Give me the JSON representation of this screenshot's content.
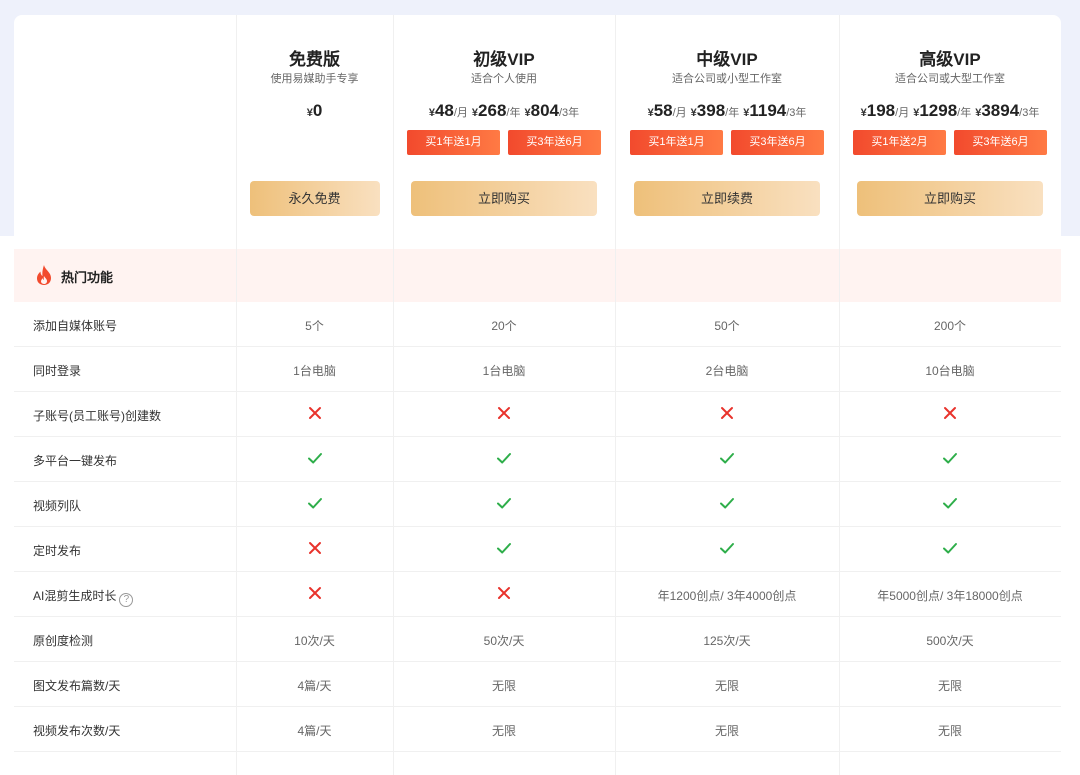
{
  "hot_title": "热门功能",
  "plans": [
    {
      "name": "免费版",
      "desc": "使用易媒助手专享",
      "prices": [
        {
          "cur": "¥",
          "amt": "0",
          "unit": ""
        }
      ],
      "promos": [],
      "button": "永久免费"
    },
    {
      "name": "初级VIP",
      "desc": "适合个人使用",
      "prices": [
        {
          "cur": "¥",
          "amt": "48",
          "unit": "/月"
        },
        {
          "cur": "¥",
          "amt": "268",
          "unit": "/年"
        },
        {
          "cur": "¥",
          "amt": "804",
          "unit": "/3年"
        }
      ],
      "promos": [
        "买1年送1月",
        "买3年送6月"
      ],
      "button": "立即购买"
    },
    {
      "name": "中级VIP",
      "desc": "适合公司或小型工作室",
      "prices": [
        {
          "cur": "¥",
          "amt": "58",
          "unit": "/月"
        },
        {
          "cur": "¥",
          "amt": "398",
          "unit": "/年"
        },
        {
          "cur": "¥",
          "amt": "1194",
          "unit": "/3年"
        }
      ],
      "promos": [
        "买1年送1月",
        "买3年送6月"
      ],
      "button": "立即续费"
    },
    {
      "name": "高级VIP",
      "desc": "适合公司或大型工作室",
      "prices": [
        {
          "cur": "¥",
          "amt": "198",
          "unit": "/月"
        },
        {
          "cur": "¥",
          "amt": "1298",
          "unit": "/年"
        },
        {
          "cur": "¥",
          "amt": "3894",
          "unit": "/3年"
        }
      ],
      "promos": [
        "买1年送2月",
        "买3年送6月"
      ],
      "button": "立即购买"
    }
  ],
  "rows": [
    {
      "feature": "添加自媒体账号",
      "values": [
        "5个",
        "20个",
        "50个",
        "200个"
      ]
    },
    {
      "feature": "同时登录",
      "values": [
        "1台电脑",
        "1台电脑",
        "2台电脑",
        "10台电脑"
      ]
    },
    {
      "feature": "子账号(员工账号)创建数",
      "values": [
        "x",
        "x",
        "x",
        "x"
      ]
    },
    {
      "feature": "多平台一键发布",
      "values": [
        "check",
        "check",
        "check",
        "check"
      ]
    },
    {
      "feature": "视频列队",
      "values": [
        "check",
        "check",
        "check",
        "check"
      ]
    },
    {
      "feature": "定时发布",
      "values": [
        "x",
        "check",
        "check",
        "check"
      ]
    },
    {
      "feature": "AI混剪生成时长",
      "help": true,
      "values": [
        "x",
        "x",
        "年1200创点/ 3年4000创点",
        "年5000创点/ 3年18000创点"
      ]
    },
    {
      "feature": "原创度检测",
      "values": [
        "10次/天",
        "50次/天",
        "125次/天",
        "500次/天"
      ]
    },
    {
      "feature": "图文发布篇数/天",
      "values": [
        "4篇/天",
        "无限",
        "无限",
        "无限"
      ]
    },
    {
      "feature": "视频发布次数/天",
      "values": [
        "4篇/天",
        "无限",
        "无限",
        "无限"
      ]
    }
  ],
  "colors": {
    "check": "#2eae4a",
    "x": "#e8332c",
    "accent": "#f24a2d"
  }
}
